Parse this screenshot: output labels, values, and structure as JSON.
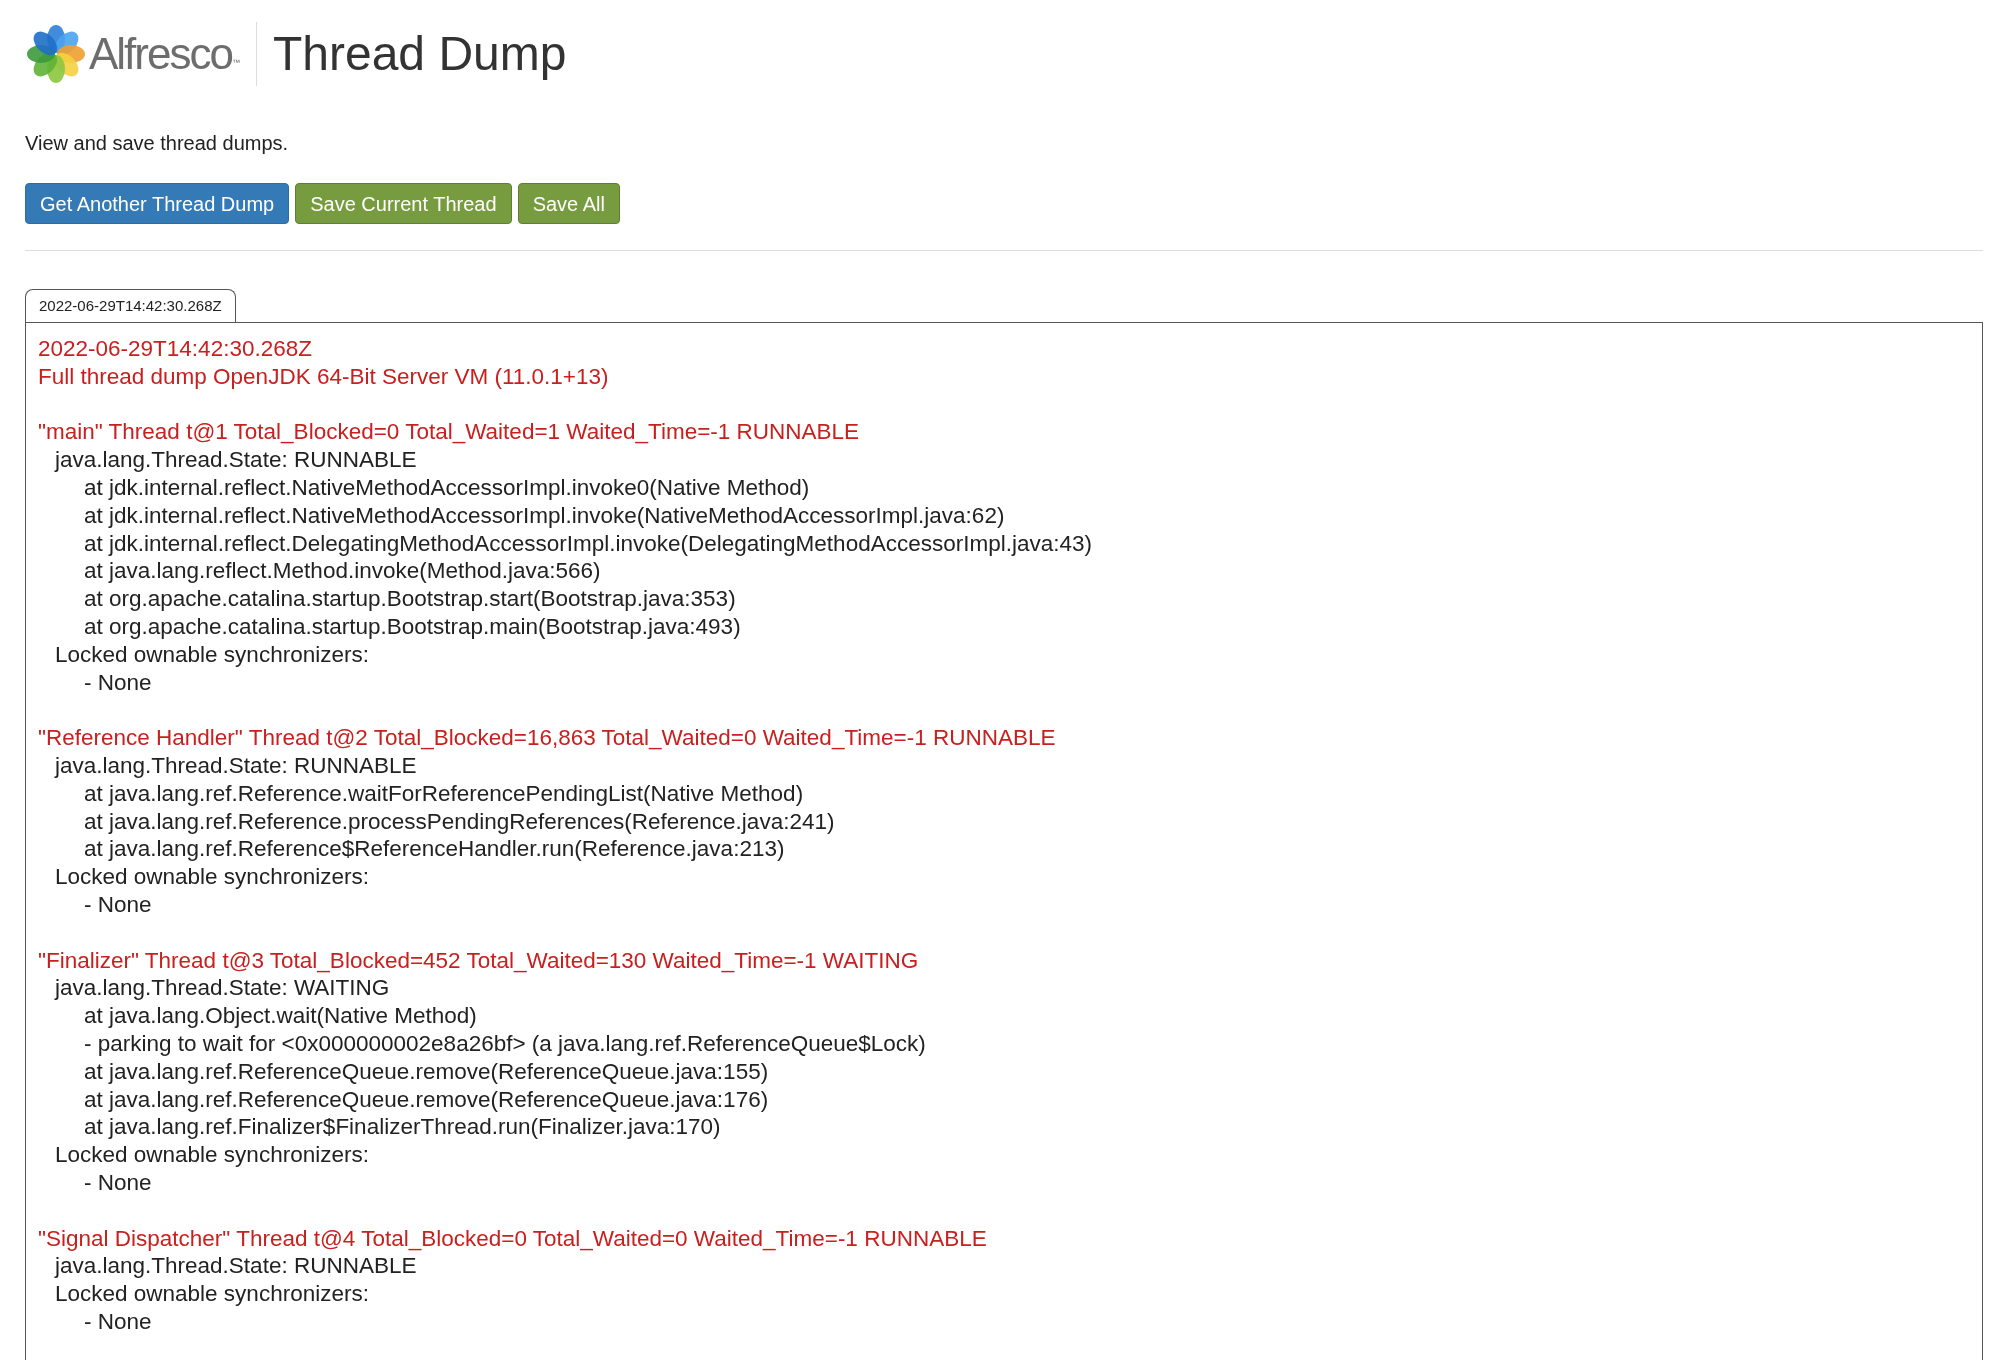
{
  "header": {
    "logo_text": "Alfresco",
    "trademark": "™",
    "title": "Thread Dump"
  },
  "description": "View and save thread dumps.",
  "buttons": [
    {
      "label": "Get Another Thread Dump",
      "kind": "primary"
    },
    {
      "label": "Save Current Thread",
      "kind": "success"
    },
    {
      "label": "Save All",
      "kind": "success"
    }
  ],
  "tabs": [
    {
      "label": "2022-06-29T14:42:30.268Z",
      "selected": true
    }
  ],
  "dump": {
    "header_lines": [
      "2022-06-29T14:42:30.268Z",
      "Full thread dump OpenJDK 64-Bit Server VM (11.0.1+13)"
    ],
    "threads": [
      {
        "header": "\"main\" Thread t@1 Total_Blocked=0 Total_Waited=1 Waited_Time=-1 RUNNABLE",
        "state": "java.lang.Thread.State: RUNNABLE",
        "frames": [
          "at jdk.internal.reflect.NativeMethodAccessorImpl.invoke0(Native Method)",
          "at jdk.internal.reflect.NativeMethodAccessorImpl.invoke(NativeMethodAccessorImpl.java:62)",
          "at jdk.internal.reflect.DelegatingMethodAccessorImpl.invoke(DelegatingMethodAccessorImpl.java:43)",
          "at java.lang.reflect.Method.invoke(Method.java:566)",
          "at org.apache.catalina.startup.Bootstrap.start(Bootstrap.java:353)",
          "at org.apache.catalina.startup.Bootstrap.main(Bootstrap.java:493)"
        ],
        "synchronizers_label": "Locked ownable synchronizers:",
        "synchronizers": [
          "- None"
        ]
      },
      {
        "header": "\"Reference Handler\" Thread t@2 Total_Blocked=16,863 Total_Waited=0 Waited_Time=-1 RUNNABLE",
        "state": "java.lang.Thread.State: RUNNABLE",
        "frames": [
          "at java.lang.ref.Reference.waitForReferencePendingList(Native Method)",
          "at java.lang.ref.Reference.processPendingReferences(Reference.java:241)",
          "at java.lang.ref.Reference$ReferenceHandler.run(Reference.java:213)"
        ],
        "synchronizers_label": "Locked ownable synchronizers:",
        "synchronizers": [
          "- None"
        ]
      },
      {
        "header": "\"Finalizer\" Thread t@3 Total_Blocked=452 Total_Waited=130 Waited_Time=-1 WAITING",
        "state": "java.lang.Thread.State: WAITING",
        "frames": [
          "at java.lang.Object.wait(Native Method)",
          "- parking to wait for <0x000000002e8a26bf> (a java.lang.ref.ReferenceQueue$Lock)",
          "at java.lang.ref.ReferenceQueue.remove(ReferenceQueue.java:155)",
          "at java.lang.ref.ReferenceQueue.remove(ReferenceQueue.java:176)",
          "at java.lang.ref.Finalizer$FinalizerThread.run(Finalizer.java:170)"
        ],
        "synchronizers_label": "Locked ownable synchronizers:",
        "synchronizers": [
          "- None"
        ]
      },
      {
        "header": "\"Signal Dispatcher\" Thread t@4 Total_Blocked=0 Total_Waited=0 Waited_Time=-1 RUNNABLE",
        "state": "java.lang.Thread.State: RUNNABLE",
        "synchronizers_label": "Locked ownable synchronizers:",
        "synchronizers": [
          "- None"
        ]
      }
    ]
  }
}
